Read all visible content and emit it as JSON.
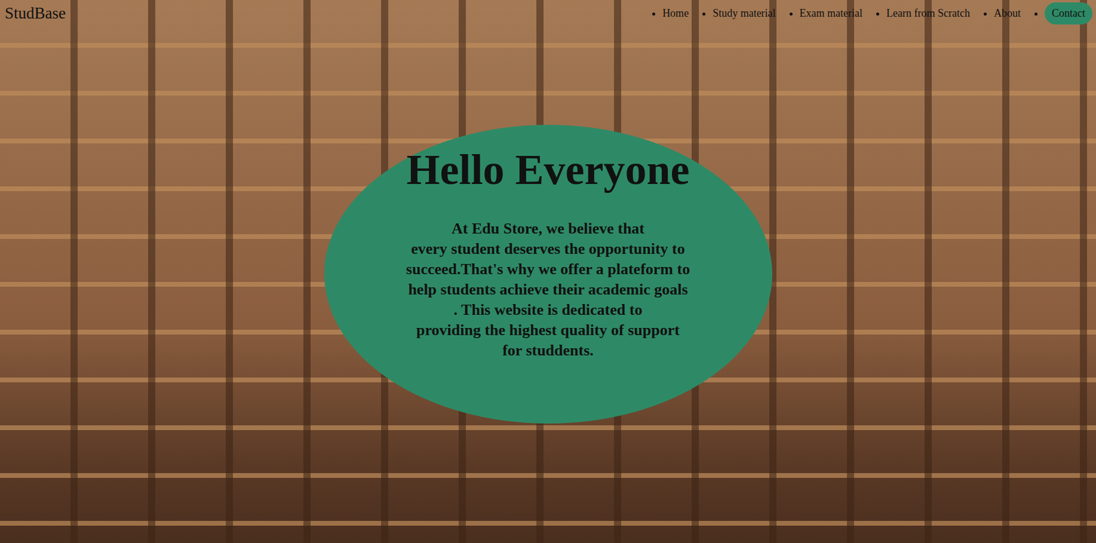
{
  "nav": {
    "logo": "StudBase",
    "links": [
      "Home",
      "Study material",
      "Exam material",
      "Learn from Scratch",
      "About"
    ],
    "contact": "Contact"
  },
  "hero": {
    "title": "Hello Everyone",
    "lines": [
      "At Edu Store, we believe that",
      "every student deserves the opportunity to",
      "succeed.That's why we offer a plateform to",
      "help students achieve their academic goals",
      ". This website is dedicated to",
      "providing the highest quality of support",
      "for studdents."
    ]
  }
}
